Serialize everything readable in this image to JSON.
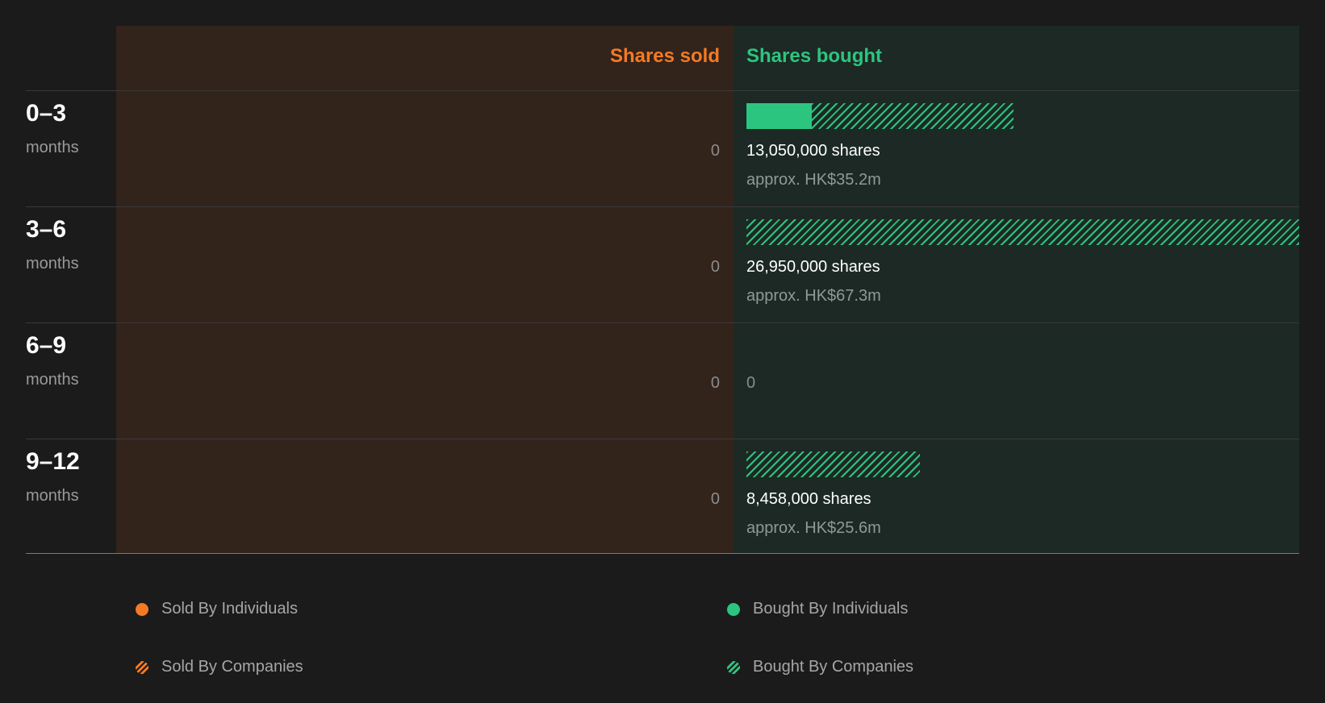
{
  "colors": {
    "sold": "#f47a25",
    "bought": "#2cc57f",
    "sold_bg": "#32231b",
    "bought_bg": "#1c2924",
    "page_bg": "#1b1b1b"
  },
  "chart_data": {
    "type": "bar",
    "orientation": "horizontal",
    "header_sold": "Shares sold",
    "header_bought": "Shares bought",
    "categories": [
      "0-3",
      "3-6",
      "6-9",
      "9-12"
    ],
    "category_unit": "months",
    "x_max_shares": 26950000,
    "rows": [
      {
        "period": "0–3",
        "unit": "months",
        "sold_label": "0",
        "sold_shares": 0,
        "bought_shares": 13050000,
        "bought_individuals_shares": 3200000,
        "bought_companies_shares": 9850000,
        "bought_label": "13,050,000 shares",
        "bought_approx": "approx. HK$35.2m"
      },
      {
        "period": "3–6",
        "unit": "months",
        "sold_label": "0",
        "sold_shares": 0,
        "bought_shares": 26950000,
        "bought_individuals_shares": 0,
        "bought_companies_shares": 26950000,
        "bought_label": "26,950,000 shares",
        "bought_approx": "approx. HK$67.3m"
      },
      {
        "period": "6–9",
        "unit": "months",
        "sold_label": "0",
        "sold_shares": 0,
        "bought_shares": 0,
        "bought_individuals_shares": 0,
        "bought_companies_shares": 0,
        "bought_zero_label": "0"
      },
      {
        "period": "9–12",
        "unit": "months",
        "sold_label": "0",
        "sold_shares": 0,
        "bought_shares": 8458000,
        "bought_individuals_shares": 0,
        "bought_companies_shares": 8458000,
        "bought_label": "8,458,000 shares",
        "bought_approx": "approx. HK$25.6m"
      }
    ],
    "legend": {
      "sold_individuals": "Sold By Individuals",
      "bought_individuals": "Bought By Individuals",
      "sold_companies": "Sold By Companies",
      "bought_companies": "Bought By Companies"
    }
  }
}
